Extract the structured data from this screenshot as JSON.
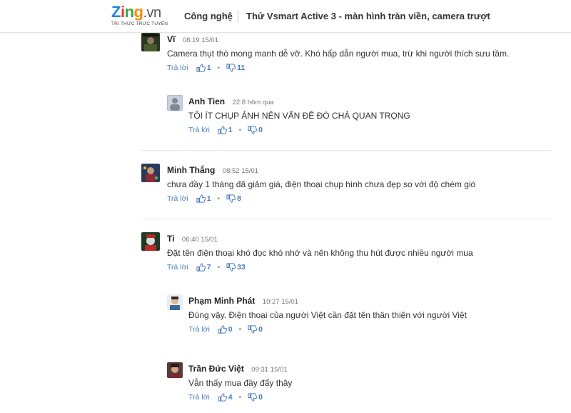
{
  "header": {
    "logo": {
      "brand": "Zing",
      "tld": ".vn",
      "tagline": "TRI THỨC TRỰC TUYẾN"
    },
    "category": "Công nghệ",
    "article_title": "Thử Vsmart Active 3 - màn hình tràn viền, camera trượt"
  },
  "comments": [
    {
      "author": "Vĩ",
      "time": "08:19 15/01",
      "text": "Camera thụt thò mong manh dễ vỡ. Khó hấp dẫn người mua, trừ khi người thích sưu tầm.",
      "reply_label": "Trả lời",
      "likes": "1",
      "dislikes": "11"
    },
    {
      "author": "Anh Tien",
      "time": "22:8 hôm qua",
      "text": "TÔI ÍT CHỤP ẢNH NÊN VẤN ĐỀ ĐÓ CHẢ QUAN TRỌNG",
      "reply_label": "Trả lời",
      "likes": "1",
      "dislikes": "0"
    },
    {
      "author": "Minh Thắng",
      "time": "08:52 15/01",
      "text": "chưa đầy 1 tháng đã giảm giá, điện thoại chụp hình chưa đẹp so với độ chém gió",
      "reply_label": "Trả lời",
      "likes": "1",
      "dislikes": "8"
    },
    {
      "author": "Ti",
      "time": "06:40 15/01",
      "text": "Đặt tên điện thoại khó đọc khó nhớ và nên không thu hút được nhiều người mua",
      "reply_label": "Trả lời",
      "likes": "7",
      "dislikes": "33"
    },
    {
      "author": "Phạm Minh Phát",
      "time": "10:27 15/01",
      "text": "Đúng vậy. Điện thoại của người Việt cần đặt tên thân thiện với người Việt",
      "reply_label": "Trả lời",
      "likes": "0",
      "dislikes": "0"
    },
    {
      "author": "Trần Đức Việt",
      "time": "09:31 15/01",
      "text": "Vẫn thấy mua đầy đẩy thây",
      "reply_label": "Trả lời",
      "likes": "4",
      "dislikes": "0"
    }
  ],
  "colors": {
    "link": "#4a7cc0",
    "divider": "#e6e6e6"
  }
}
